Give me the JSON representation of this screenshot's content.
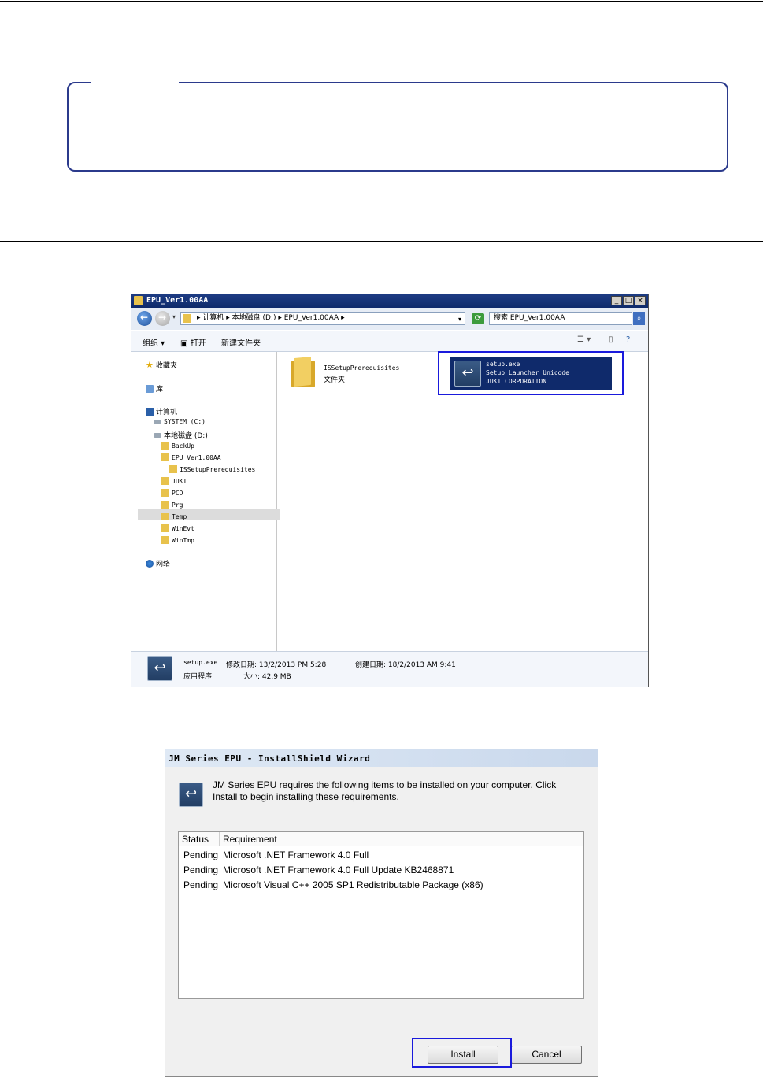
{
  "explorer": {
    "title": "EPU_Ver1.00AA",
    "win_buttons": [
      "_",
      "□",
      "×"
    ],
    "address_path": "▸ 计算机 ▸ 本地磁盘 (D:) ▸ EPU_Ver1.00AA ▸",
    "search_placeholder": "搜索 EPU_Ver1.00AA",
    "toolbar": {
      "organize": "组织 ▾",
      "open": "打开",
      "new_folder": "新建文件夹"
    },
    "nav": {
      "favorites": "收藏夹",
      "libraries": "库",
      "computer": "计算机",
      "system_drive": "SYSTEM (C:)",
      "local_disk": "本地磁盘 (D:)",
      "folders": [
        "BackUp",
        "EPU_Ver1.00AA",
        "ISSetupPrerequisites",
        "JUKI",
        "PCD",
        "Prg",
        "Temp",
        "WinEvt",
        "WinTmp"
      ],
      "network": "网络"
    },
    "items": {
      "folder_name": "ISSetupPrerequisites",
      "folder_type": "文件夹",
      "setup_name": "setup.exe",
      "setup_desc": "Setup Launcher Unicode",
      "setup_company": "JUKI CORPORATION"
    },
    "details": {
      "name": "setup.exe",
      "modified": "修改日期: 13/2/2013 PM 5:28",
      "created": "创建日期: 18/2/2013 AM 9:41",
      "type": "应用程序",
      "size": "大小: 42.9 MB"
    }
  },
  "installer": {
    "title": "JM Series EPU - InstallShield Wizard",
    "message": "JM Series EPU requires the following items to be installed on your computer. Click Install to begin installing these requirements.",
    "columns": [
      "Status",
      "Requirement"
    ],
    "rows": [
      {
        "status": "Pending",
        "requirement": "Microsoft .NET Framework 4.0 Full"
      },
      {
        "status": "Pending",
        "requirement": "Microsoft .NET Framework 4.0 Full Update KB2468871"
      },
      {
        "status": "Pending",
        "requirement": "Microsoft Visual C++ 2005 SP1 Redistributable Package (x86)"
      }
    ],
    "install_label": "Install",
    "cancel_label": "Cancel"
  },
  "colors": {
    "highlight": "#1a1adc",
    "note_border": "#2b3a8c",
    "selection": "#0f2a6b"
  }
}
